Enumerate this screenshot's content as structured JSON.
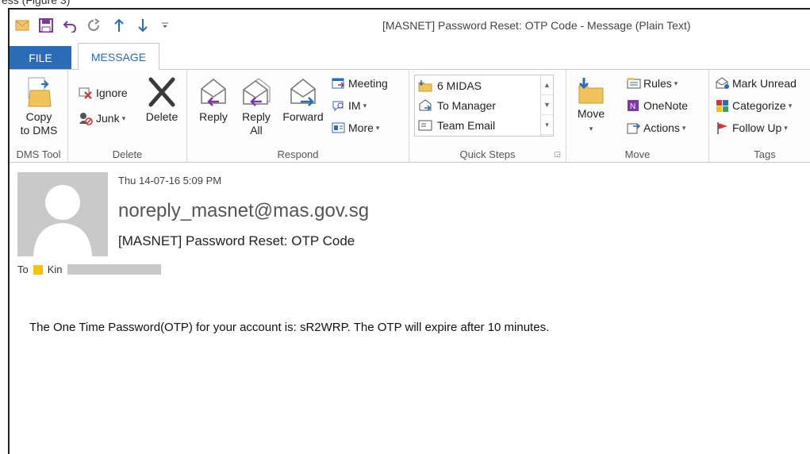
{
  "caption": "ess (Figure 3)",
  "window_title": "[MASNET] Password Reset: OTP Code - Message (Plain Text)",
  "tabs": {
    "file": "FILE",
    "message": "MESSAGE"
  },
  "ribbon": {
    "dms": {
      "copy_line1": "Copy",
      "copy_line2": "to DMS",
      "label": "DMS Tool"
    },
    "delete": {
      "ignore": "Ignore",
      "junk": "Junk",
      "delete": "Delete",
      "label": "Delete"
    },
    "respond": {
      "reply": "Reply",
      "reply_all_line1": "Reply",
      "reply_all_line2": "All",
      "forward": "Forward",
      "meeting": "Meeting",
      "im": "IM",
      "more": "More",
      "label": "Respond"
    },
    "quick_steps": {
      "items": [
        "6 MIDAS",
        "To Manager",
        "Team Email"
      ],
      "label": "Quick Steps"
    },
    "move": {
      "move": "Move",
      "rules": "Rules",
      "onenote": "OneNote",
      "actions": "Actions",
      "label": "Move"
    },
    "tags": {
      "mark_unread": "Mark Unread",
      "categorize": "Categorize",
      "follow_up": "Follow Up",
      "label": "Tags"
    }
  },
  "message": {
    "date": "Thu 14-07-16 5:09 PM",
    "from": "noreply_masnet@mas.gov.sg",
    "subject": "[MASNET] Password Reset: OTP Code",
    "to_label": "To",
    "to_name": "Kin",
    "body": "The One Time Password(OTP) for your account is: sR2WRP. The OTP will expire after 10 minutes."
  },
  "colors": {
    "file_tab": "#2b6cb6",
    "category": "#f5c400",
    "avatar_bg": "#c9c9c9"
  }
}
